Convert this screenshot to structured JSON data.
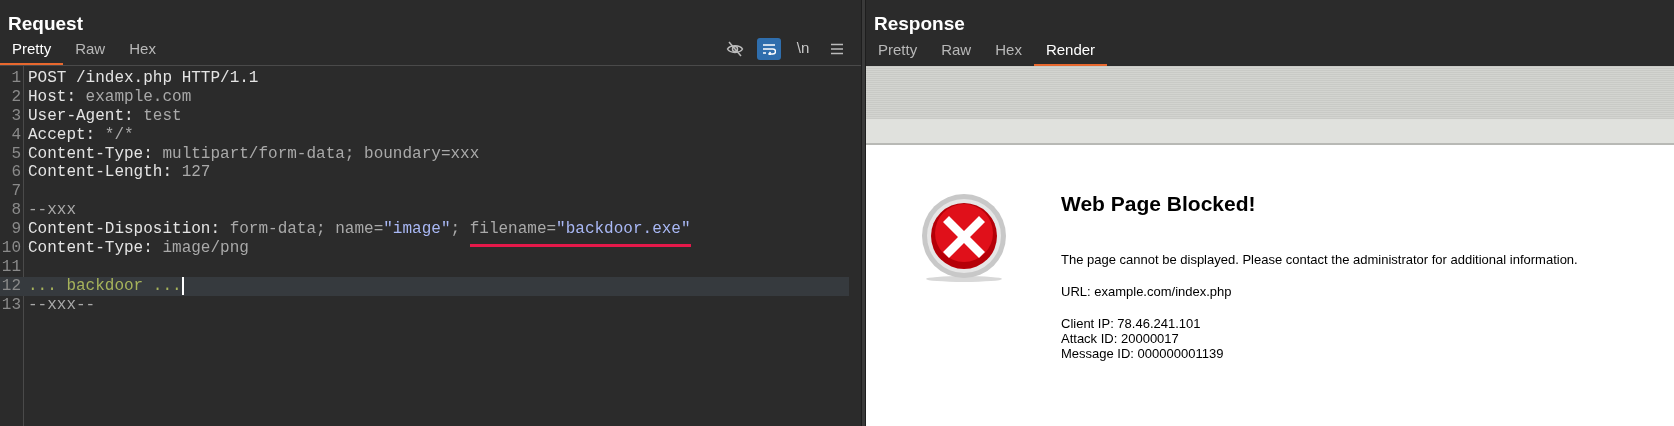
{
  "request": {
    "title": "Request",
    "tabs": [
      {
        "label": "Pretty",
        "selected": true
      },
      {
        "label": "Raw",
        "selected": false
      },
      {
        "label": "Hex",
        "selected": false
      }
    ],
    "toolbar": [
      {
        "kind": "hide",
        "selected": false
      },
      {
        "kind": "wrap",
        "selected": true
      },
      {
        "kind": "newline",
        "label": "\\n",
        "selected": false
      },
      {
        "kind": "menu"
      }
    ],
    "lines": [
      {
        "number": "1",
        "tokens": [
          {
            "text": "POST /index.php HTTP/1.1",
            "kind": "name"
          }
        ]
      },
      {
        "number": "2",
        "tokens": [
          {
            "text": "Host:",
            "kind": "name"
          },
          {
            "text": " example.com",
            "kind": "value"
          }
        ]
      },
      {
        "number": "3",
        "tokens": [
          {
            "text": "User-Agent:",
            "kind": "name"
          },
          {
            "text": " test",
            "kind": "value"
          }
        ]
      },
      {
        "number": "4",
        "tokens": [
          {
            "text": "Accept:",
            "kind": "name"
          },
          {
            "text": " */*",
            "kind": "value"
          }
        ]
      },
      {
        "number": "5",
        "tokens": [
          {
            "text": "Content-Type:",
            "kind": "name"
          },
          {
            "text": " multipart/form-data; boundary=xxx",
            "kind": "value"
          }
        ]
      },
      {
        "number": "6",
        "tokens": [
          {
            "text": "Content-Length:",
            "kind": "name"
          },
          {
            "text": " 127",
            "kind": "value"
          }
        ]
      },
      {
        "number": "7"
      },
      {
        "number": "8",
        "tokens": [
          {
            "text": "--xxx",
            "kind": "value"
          }
        ]
      },
      {
        "number": "9",
        "tokens": [
          {
            "text": "Content-Disposition:",
            "kind": "name"
          },
          {
            "text": " form-data; name=",
            "kind": "value"
          },
          {
            "text": "\"image\"",
            "kind": "string"
          },
          {
            "text": "; ",
            "kind": "value"
          },
          {
            "text": "filename=",
            "kind": "value",
            "underlined": true
          },
          {
            "text": "\"backdoor.exe\"",
            "kind": "string",
            "underlined": true
          }
        ]
      },
      {
        "number": "10",
        "tokens": [
          {
            "text": "Content-Type:",
            "kind": "name"
          },
          {
            "text": " image/png",
            "kind": "value"
          }
        ]
      },
      {
        "number": "11"
      },
      {
        "number": "12",
        "current": true,
        "tokens": [
          {
            "text": "... backdoor ...",
            "kind": "body"
          }
        ]
      },
      {
        "number": "13",
        "tokens": [
          {
            "text": "--xxx--",
            "kind": "value"
          }
        ]
      }
    ]
  },
  "response": {
    "title": "Response",
    "tabs": [
      {
        "label": "Pretty",
        "selected": false
      },
      {
        "label": "Raw",
        "selected": false
      },
      {
        "label": "Hex",
        "selected": false
      },
      {
        "label": "Render",
        "selected": true
      }
    ],
    "render": {
      "heading": "Web Page Blocked!",
      "message": "The page cannot be displayed. Please contact the administrator for additional information.",
      "url": "URL: example.com/index.php",
      "details": [
        "Client IP: 78.46.241.101",
        "Attack ID: 20000017",
        "Message ID: 000000001139"
      ]
    }
  }
}
